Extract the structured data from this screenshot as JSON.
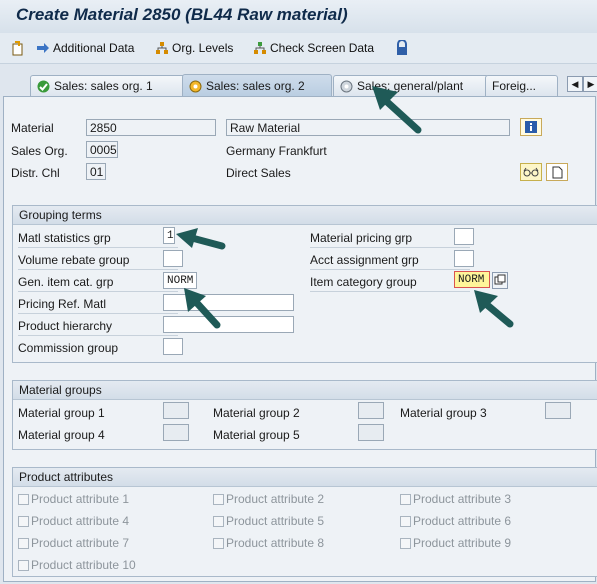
{
  "title": "Create Material 2850 (BL44 Raw material)",
  "toolbar": {
    "additional_data": "Additional Data",
    "org_levels": "Org. Levels",
    "check_screen_data": "Check Screen Data"
  },
  "tabs": [
    {
      "label": "Sales: sales org. 1"
    },
    {
      "label": "Sales: sales org. 2"
    },
    {
      "label": "Sales: general/plant"
    },
    {
      "label": "Foreig..."
    }
  ],
  "header": {
    "material_label": "Material",
    "material_value": "2850",
    "material_desc": "Raw Material",
    "sales_org_label": "Sales Org.",
    "sales_org_value": "0005",
    "sales_org_desc": "Germany Frankfurt",
    "distr_chl_label": "Distr. Chl",
    "distr_chl_value": "01",
    "distr_chl_desc": "Direct Sales"
  },
  "grouping": {
    "title": "Grouping terms",
    "matl_statistics_grp_label": "Matl statistics grp",
    "matl_statistics_grp_value": "1",
    "volume_rebate_group_label": "Volume rebate group",
    "gen_item_cat_grp_label": "Gen. item cat. grp",
    "gen_item_cat_grp_value": "NORM",
    "pricing_ref_matl_label": "Pricing Ref. Matl",
    "product_hierarchy_label": "Product hierarchy",
    "commission_group_label": "Commission group",
    "material_pricing_grp_label": "Material pricing grp",
    "acct_assignment_grp_label": "Acct assignment grp",
    "item_category_group_label": "Item category group",
    "item_category_group_value": "NORM"
  },
  "material_groups": {
    "title": "Material groups",
    "items": [
      "Material group 1",
      "Material group 2",
      "Material group 3",
      "Material group 4",
      "Material group 5"
    ]
  },
  "product_attributes": {
    "title": "Product attributes",
    "items": [
      "Product attribute 1",
      "Product attribute 2",
      "Product attribute 3",
      "Product attribute 4",
      "Product attribute 5",
      "Product attribute 6",
      "Product attribute 7",
      "Product attribute 8",
      "Product attribute 9",
      "Product attribute 10"
    ]
  },
  "colors": {
    "annotation_arrow": "#1f5a57",
    "highlight_field": "#fff59a",
    "required_border": "#d9534f"
  }
}
